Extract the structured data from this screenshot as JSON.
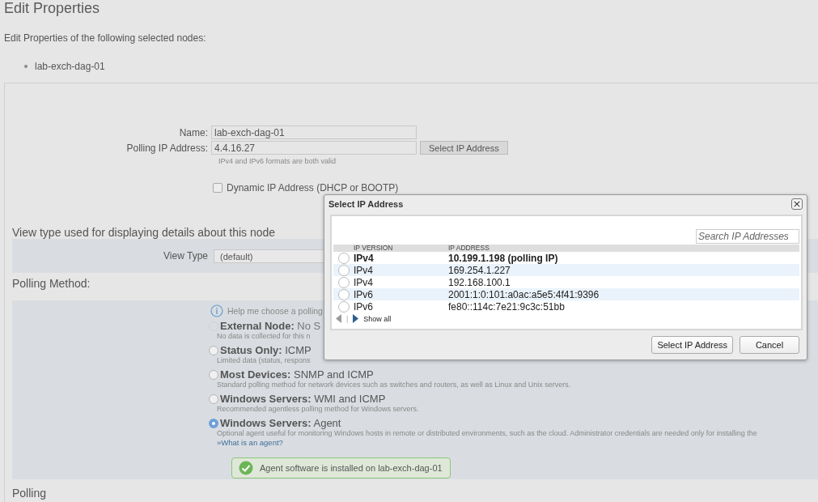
{
  "page": {
    "title": "Edit Properties",
    "intro": "Edit Properties of the following selected nodes:",
    "nodes": [
      "lab-exch-dag-01"
    ]
  },
  "form": {
    "name_label": "Name:",
    "name_value": "lab-exch-dag-01",
    "ip_label": "Polling IP Address:",
    "ip_value": "4.4.16.27",
    "select_ip_button": "Select IP Address",
    "ip_hint": "IPv4 and IPv6 formats are both valid",
    "dynamic_ip": {
      "label": "Dynamic IP Address (DHCP or BOOTP)",
      "checked": false
    }
  },
  "view_type": {
    "heading": "View type used for displaying details about this node",
    "label": "View Type",
    "value": "(default)"
  },
  "polling_method": {
    "heading": "Polling Method:",
    "help": "Help me choose a polling",
    "options": [
      {
        "label": "**External Node:** No S",
        "description": "No data is collected for this n",
        "selected": false,
        "disabled": true
      },
      {
        "label": "**Status Only:** ICMP",
        "description": "Limited data (status, respons",
        "selected": false,
        "disabled": false
      },
      {
        "label": "**Most Devices:** SNMP and ICMP",
        "description": "Standard polling method for network devices such as switches and routers, as well as Linux and Unix servers.",
        "selected": false,
        "disabled": false
      },
      {
        "label": "**Windows Servers:** WMI and ICMP",
        "description": "Recommended agentless polling method for Windows servers.",
        "selected": false,
        "disabled": false
      },
      {
        "label": "**Windows Servers:** Agent",
        "description": "Optional agent useful for monitoring Windows hosts in remote or distributed environments, such as the cloud. Administrator credentials are needed only for installing the",
        "link": "»What is an agent?",
        "selected": true,
        "disabled": false
      }
    ],
    "status": "Agent software is installed on lab-exch-dag-01"
  },
  "next_section": {
    "heading": "Polling"
  },
  "dialog": {
    "title": "Select IP Address",
    "close": "×",
    "search": {
      "placeholder": "Search IP Addresses"
    },
    "columns": [
      "IP VERSION",
      "IP ADDRESS"
    ],
    "rows": [
      {
        "version": "IPv4",
        "address": "10.199.1.198 (polling IP)",
        "polling": true,
        "selected": false
      },
      {
        "version": "IPv4",
        "address": "169.254.1.227",
        "polling": false,
        "selected": false
      },
      {
        "version": "IPv4",
        "address": "192.168.100.1",
        "polling": false,
        "selected": false
      },
      {
        "version": "IPv6",
        "address": "2001:1:0:101:a0ac:a5e5:4f41:9396",
        "polling": false,
        "selected": false
      },
      {
        "version": "IPv6",
        "address": "fe80::114c:7e21:9c3c:51bb",
        "polling": false,
        "selected": false
      }
    ],
    "pager": {
      "separator": "|",
      "show_all": "Show all"
    },
    "buttons": [
      "Select IP Address",
      "Cancel"
    ]
  }
}
